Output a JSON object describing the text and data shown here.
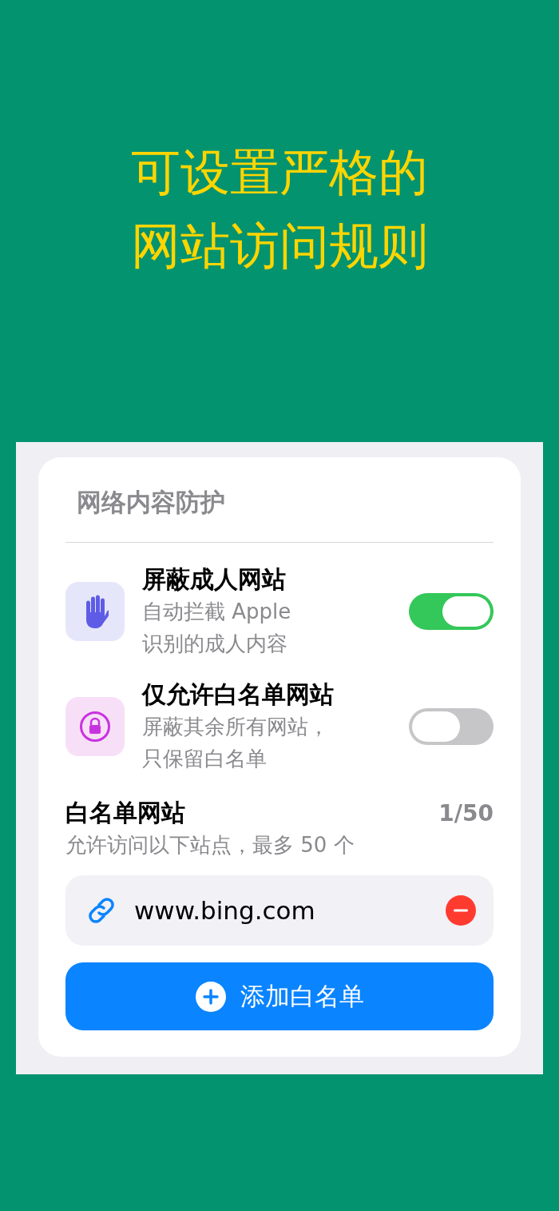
{
  "headline": [
    "可设置严格的",
    "网站访问规则"
  ],
  "section": {
    "title": "网络内容防护",
    "toggles": [
      {
        "kind": "hand",
        "title": "屏蔽成人网站",
        "subtitle": [
          "自动拦截 Apple",
          "识别的成人内容"
        ],
        "on": true
      },
      {
        "kind": "lock",
        "title": "仅允许白名单网站",
        "subtitle": [
          "屏蔽其余所有网站，",
          "只保留白名单"
        ],
        "on": false
      }
    ],
    "whitelist": {
      "title": "白名单网站",
      "count": "1/50",
      "subtitle": "允许访问以下站点，最多 50 个",
      "entries": [
        {
          "url": "www.bing.com"
        }
      ],
      "add_button": "添加白名单"
    }
  }
}
